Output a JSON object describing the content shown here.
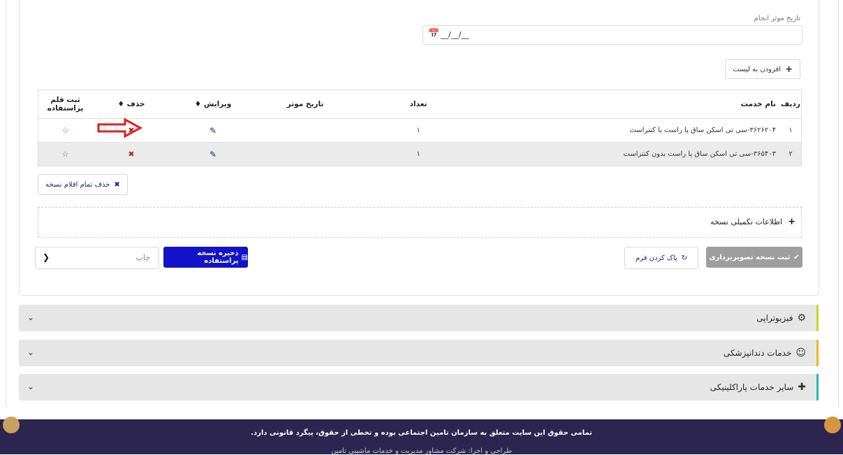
{
  "form": {
    "date_label": "تاریخ موثر انجام",
    "date_value": "__/__/__",
    "add_to_list": "افزودن به لیست"
  },
  "table": {
    "headers": {
      "idx": "ردیف",
      "name": "نام خدمت",
      "count": "تعداد",
      "date": "تاریخ موثر",
      "edit": "ویرایش ♦",
      "del": "حذف ♦",
      "reg": "ثبت قلم پراستفاده"
    },
    "rows": [
      {
        "idx": "۱",
        "name": "۳۶۲۶۲۰۴-سی تی اسکن ساق پا راست با کنتراست",
        "count": "۱",
        "date": ""
      },
      {
        "idx": "۲",
        "name": "۳۶۵۴۰۳-سی تی اسکن ساق پا راست بدون کنتراست",
        "count": "۱",
        "date": ""
      }
    ]
  },
  "actions": {
    "delete_all": "حذف تمام اقلام نسخه",
    "extra_info": "اطلاعات تکمیلی نسخه",
    "print_placeholder": "چاپ",
    "save_frequent": "ذخیره نسخه پراستفاده",
    "clear_form": "پاک کردن فرم",
    "submit_imaging": "ثبت نسخه تصویربرداری"
  },
  "accordions": [
    {
      "title": "فیزیوتراپی",
      "icon": "physiotherapy-icon",
      "color": "#c8d820"
    },
    {
      "title": "خدمات دندانپزشکی",
      "icon": "dentist-icon",
      "color": "#f0b429"
    },
    {
      "title": "سایر خدمات پاراکلینیکی",
      "icon": "medical-cross-icon",
      "color": "#27b6c0"
    }
  ],
  "footer": {
    "copyright": "تمامی حقوق این سایت متعلق به سازمان تامین اجتماعی بوده و تخطی از حقوق، پیگرد قانونی دارد.",
    "credit": "طراحی و اجرا: شرکت مشاور مدیریت و خدمات ماشینی تامین"
  },
  "colors": {
    "primary": "#1212c8",
    "footer_bg": "#2b2550",
    "danger": "#c0262c"
  }
}
